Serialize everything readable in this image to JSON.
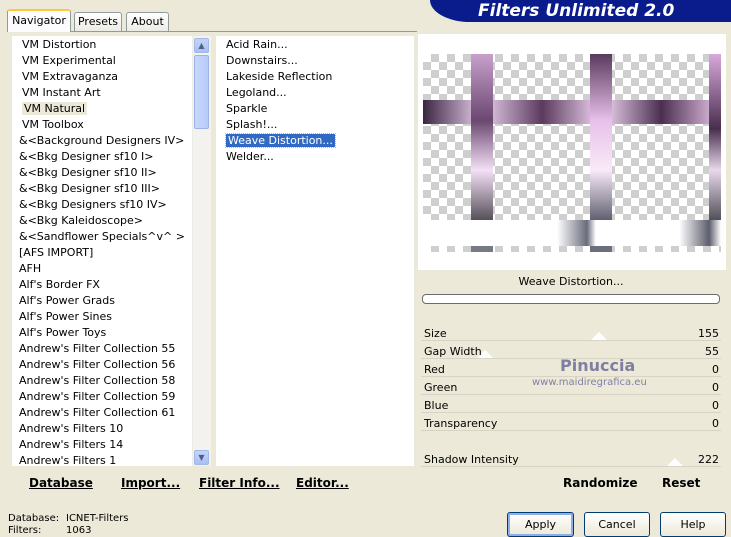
{
  "tabs": [
    {
      "label": "Navigator",
      "active": true
    },
    {
      "label": "Presets",
      "active": false
    },
    {
      "label": "About",
      "active": false
    }
  ],
  "banner": {
    "title": "Filters Unlimited 2.0"
  },
  "categories": [
    {
      "label": "VM Distortion"
    },
    {
      "label": "VM Experimental"
    },
    {
      "label": "VM Extravaganza"
    },
    {
      "label": "VM Instant Art"
    },
    {
      "label": "VM Natural",
      "state": "highlighted"
    },
    {
      "label": "VM Toolbox"
    },
    {
      "label": "&<Background Designers IV>"
    },
    {
      "label": "&<Bkg Designer sf10 I>"
    },
    {
      "label": "&<Bkg Designer sf10 II>"
    },
    {
      "label": "&<Bkg Designer sf10 III>"
    },
    {
      "label": "&<Bkg Designers sf10 IV>"
    },
    {
      "label": "&<Bkg Kaleidoscope>"
    },
    {
      "label": "&<Sandflower Specials^v^ >"
    },
    {
      "label": "[AFS IMPORT]"
    },
    {
      "label": "AFH"
    },
    {
      "label": "Alf's Border FX"
    },
    {
      "label": "Alf's Power Grads"
    },
    {
      "label": "Alf's Power Sines"
    },
    {
      "label": "Alf's Power Toys"
    },
    {
      "label": "Andrew's Filter Collection 55"
    },
    {
      "label": "Andrew's Filter Collection 56"
    },
    {
      "label": "Andrew's Filter Collection 58"
    },
    {
      "label": "Andrew's Filter Collection 59"
    },
    {
      "label": "Andrew's Filter Collection 61"
    },
    {
      "label": "Andrew's Filters 10"
    },
    {
      "label": "Andrew's Filters 14"
    },
    {
      "label": "Andrew's Filters 1"
    }
  ],
  "filters": [
    {
      "label": "Acid Rain..."
    },
    {
      "label": "Downstairs..."
    },
    {
      "label": "Lakeside Reflection"
    },
    {
      "label": "Legoland..."
    },
    {
      "label": "Sparkle"
    },
    {
      "label": "Splash!..."
    },
    {
      "label": "Weave Distortion...",
      "state": "selected"
    },
    {
      "label": "Welder..."
    }
  ],
  "toolbar": {
    "database": "Database",
    "import": "Import...",
    "filter_info": "Filter Info...",
    "editor": "Editor...",
    "randomize": "Randomize",
    "reset": "Reset"
  },
  "filter_name": "Weave Distortion...",
  "progress": 0,
  "parameters": [
    {
      "label": "Size",
      "value": "155",
      "level": 0.61
    },
    {
      "label": "Gap Width",
      "value": "55",
      "level": 0.22
    },
    {
      "label": "Red",
      "value": "0",
      "level": 0
    },
    {
      "label": "Green",
      "value": "0",
      "level": 0
    },
    {
      "label": "Blue",
      "value": "0",
      "level": 0
    },
    {
      "label": "Transparency",
      "value": "0",
      "level": 0
    },
    {
      "label": "Shadow Intensity",
      "value": "222",
      "level": 0.87
    }
  ],
  "watermark": {
    "name": "Pinuccia",
    "url": "www.maidiregrafica.eu"
  },
  "footer": {
    "database_label": "Database:",
    "database_value": "ICNET-Filters",
    "filters_label": "Filters:",
    "filters_value": "1063"
  },
  "buttons": {
    "apply": "Apply",
    "cancel": "Cancel",
    "help": "Help"
  },
  "colors": {
    "window_bg": "#ece9d8",
    "banner_bg": "#0a1c8c",
    "selection": "#316ac5",
    "weave_purple": "#5a3a5e",
    "weave_pink": "#e8b4ea"
  }
}
